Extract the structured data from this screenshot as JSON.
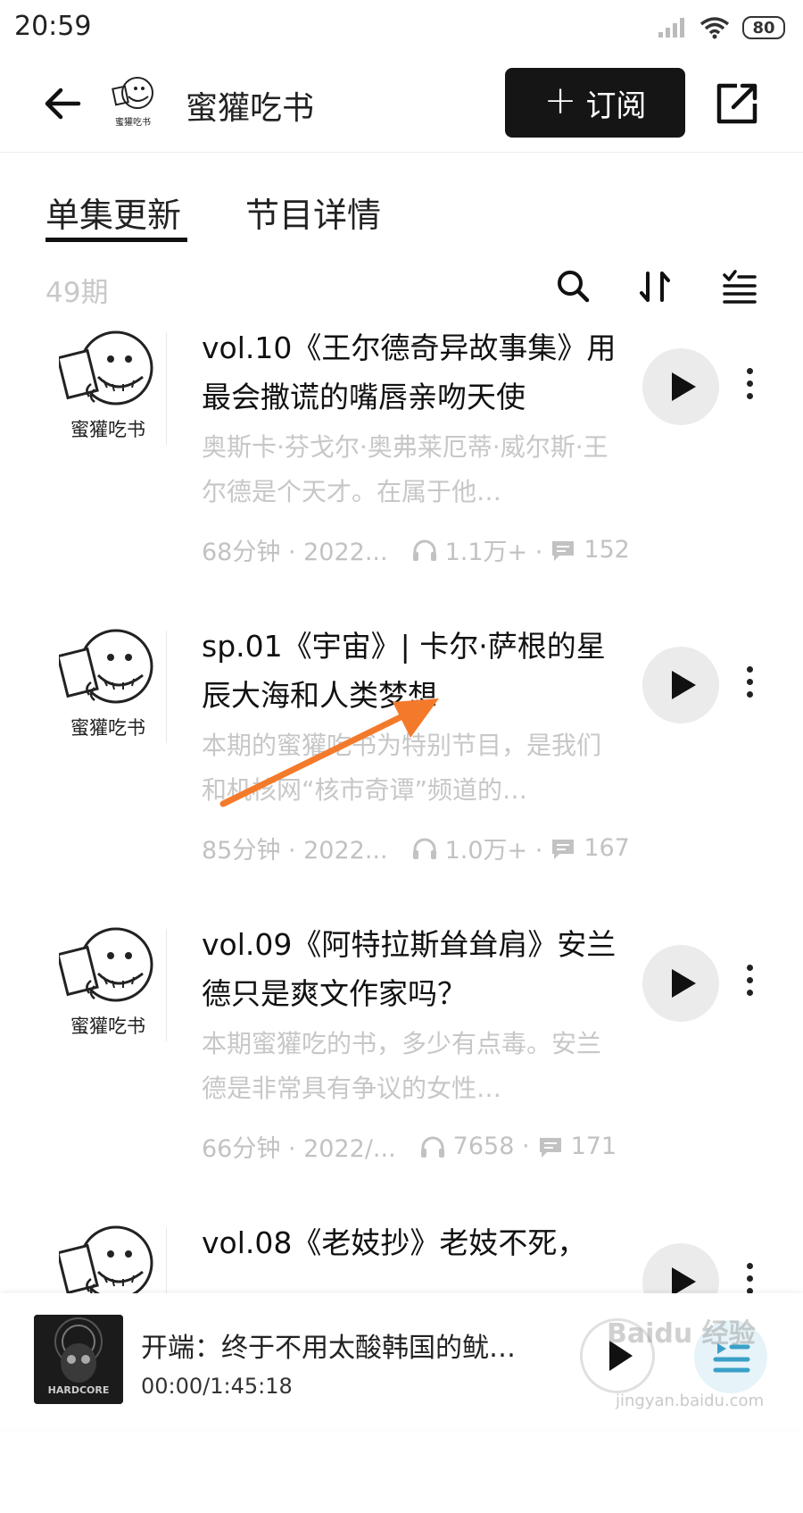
{
  "status_bar": {
    "time": "20:59",
    "battery": "80"
  },
  "header": {
    "title": "蜜獾吃书",
    "subscribe_label": "订阅",
    "subscribe_plus": "+"
  },
  "tabs": [
    {
      "label": "单集更新",
      "active": true
    },
    {
      "label": "节目详情",
      "active": false
    }
  ],
  "toolbar": {
    "episode_count": "49期",
    "icons": [
      "search-icon",
      "sort-icon",
      "multi-select-icon"
    ]
  },
  "logo_text": "蜜獾吃书",
  "episodes": [
    {
      "title": "vol.10《王尔德奇异故事集》用最会撒谎的嘴唇亲吻天使",
      "desc": "奥斯卡·芬戈尔·奥弗莱厄蒂·威尔斯·王尔德是个天才。在属于他…",
      "duration": "68分钟 · 2022...",
      "plays": "1.1万+ ·",
      "comments": "152"
    },
    {
      "title": "sp.01《宇宙》| 卡尔·萨根的星辰大海和人类梦想",
      "desc": "本期的蜜獾吃书为特别节目，是我们和机核网“核市奇谭”频道的…",
      "duration": "85分钟 · 2022...",
      "plays": "1.0万+ ·",
      "comments": "167"
    },
    {
      "title": "vol.09《阿特拉斯耸耸肩》安兰德只是爽文作家吗？",
      "desc": "本期蜜獾吃的书，多少有点毒。安兰德是非常具有争议的女性…",
      "duration": "66分钟 · 2022/...",
      "plays": "7658 ·",
      "comments": "171"
    },
    {
      "title": "vol.08《老妓抄》老妓不死，",
      "desc": "",
      "duration": "",
      "plays": "",
      "comments": ""
    }
  ],
  "mini_player": {
    "title": "开端：终于不用太酸韩国的鱿…",
    "time": "00:00/1:45:18",
    "cover_text": "HARDCORE"
  },
  "watermark": {
    "main": "Baidu 经验",
    "sub": "jingyan.baidu.com"
  },
  "colors": {
    "accent": "#151515",
    "muted": "#c7c7c7",
    "arrow": "#f47a2b"
  }
}
